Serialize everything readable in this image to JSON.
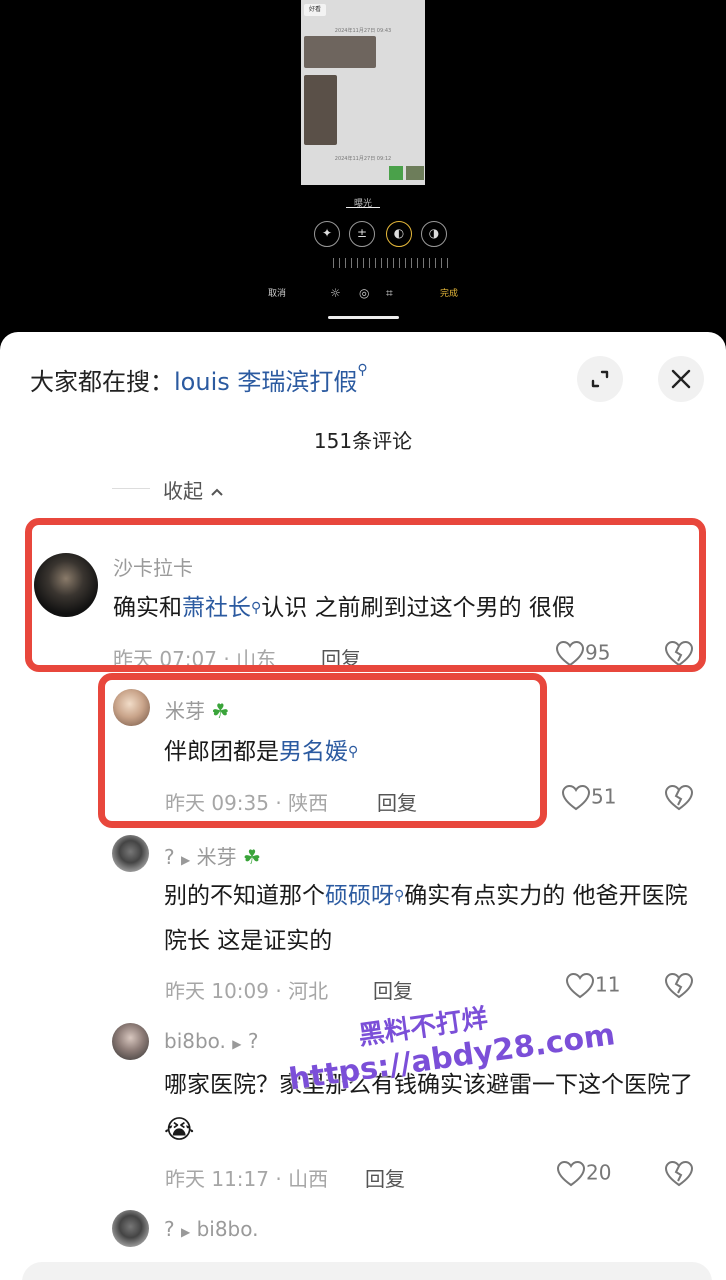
{
  "editor": {
    "chip": "好看",
    "date_top": "2024年11月27日 09:43",
    "date_bottom": "2024年11月27日 09:12",
    "green_chip": "好的",
    "mode_label": "曝光",
    "cancel": "取消",
    "done": "完成"
  },
  "search": {
    "prefix": "大家都在搜：",
    "term": "louis 李瑞滨打假"
  },
  "comment_count": "151条评论",
  "collapse_label": "收起",
  "comments": [
    {
      "user": "沙卡拉卡",
      "text_a": "确实和",
      "link": "萧社长",
      "text_b": "认识 之前刷到过这个男的 很假",
      "meta": "昨天 07:07 · 山东",
      "reply": "回复",
      "likes": "95"
    },
    {
      "user": "米芽",
      "text_a": "伴郎团都是",
      "link": "男名媛",
      "meta": "昨天 09:35 · 陕西",
      "reply": "回复",
      "likes": "51"
    },
    {
      "user": "?",
      "reply_to": "米芽",
      "text_a": "别的不知道那个",
      "link": "硕硕呀",
      "text_b": "确实有点实力的 他爸开医院院长 这是证实的",
      "meta": "昨天 10:09 · 河北",
      "reply": "回复",
      "likes": "11"
    },
    {
      "user": "bi8bo.",
      "reply_to": "?",
      "text_a": "哪家医院？家里那么有钱确实该避雷一下这个医院了",
      "meta": "昨天 11:17 · 山西",
      "reply": "回复",
      "likes": "20"
    },
    {
      "user": "?",
      "reply_to": "bi8bo."
    }
  ],
  "watermark": {
    "line1": "黑料不打烊",
    "line2": "https://abdy28.com"
  },
  "colors": {
    "highlight": "#e8473c",
    "link": "#2b5aa0",
    "editor_accent": "#e7b93a"
  }
}
